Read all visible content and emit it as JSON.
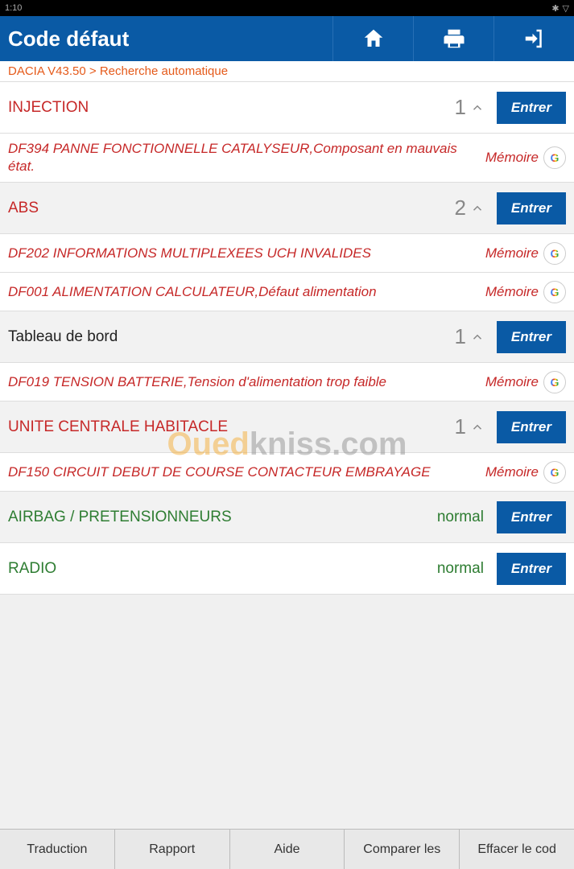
{
  "status_bar": {
    "time": "1:10",
    "bt_icon": "bluetooth",
    "wifi_icon": "wifi"
  },
  "header": {
    "title": "Code défaut",
    "home_icon": "home",
    "print_icon": "print",
    "exit_icon": "exit"
  },
  "breadcrumb": "DACIA V43.50 > Recherche automatique",
  "modules": [
    {
      "name": "INJECTION",
      "count": "1",
      "btn": "Entrer",
      "fault_color": "red",
      "faults": [
        {
          "text": "DF394 PANNE FONCTIONNELLE CATALYSEUR,Composant en mauvais état.",
          "status": "Mémoire"
        }
      ]
    },
    {
      "name": "ABS",
      "count": "2",
      "btn": "Entrer",
      "fault_color": "red",
      "faults": [
        {
          "text": "DF202 INFORMATIONS MULTIPLEXEES UCH INVALIDES",
          "status": "Mémoire"
        },
        {
          "text": "DF001 ALIMENTATION CALCULATEUR,Défaut alimentation",
          "status": "Mémoire"
        }
      ]
    },
    {
      "name": "Tableau de bord",
      "count": "1",
      "btn": "Entrer",
      "fault_color": "black",
      "faults": [
        {
          "text": "DF019 TENSION BATTERIE,Tension d'alimentation trop faible",
          "status": "Mémoire"
        }
      ]
    },
    {
      "name": "UNITE CENTRALE HABITACLE",
      "count": "1",
      "btn": "Entrer",
      "fault_color": "red",
      "faults": [
        {
          "text": "DF150 CIRCUIT DEBUT DE COURSE CONTACTEUR EMBRAYAGE",
          "status": "Mémoire"
        }
      ]
    },
    {
      "name": "AIRBAG / PRETENSIONNEURS",
      "status": "normal",
      "btn": "Entrer",
      "fault_color": "green",
      "faults": []
    },
    {
      "name": "RADIO",
      "status": "normal",
      "btn": "Entrer",
      "fault_color": "green",
      "faults": []
    }
  ],
  "bottom": {
    "translate": "Traduction",
    "report": "Rapport",
    "help": "Aide",
    "compare": "Comparer les",
    "clear": "Effacer le cod"
  },
  "watermark": {
    "part1": "Oued",
    "part2": "kniss",
    "part3": ".com"
  }
}
